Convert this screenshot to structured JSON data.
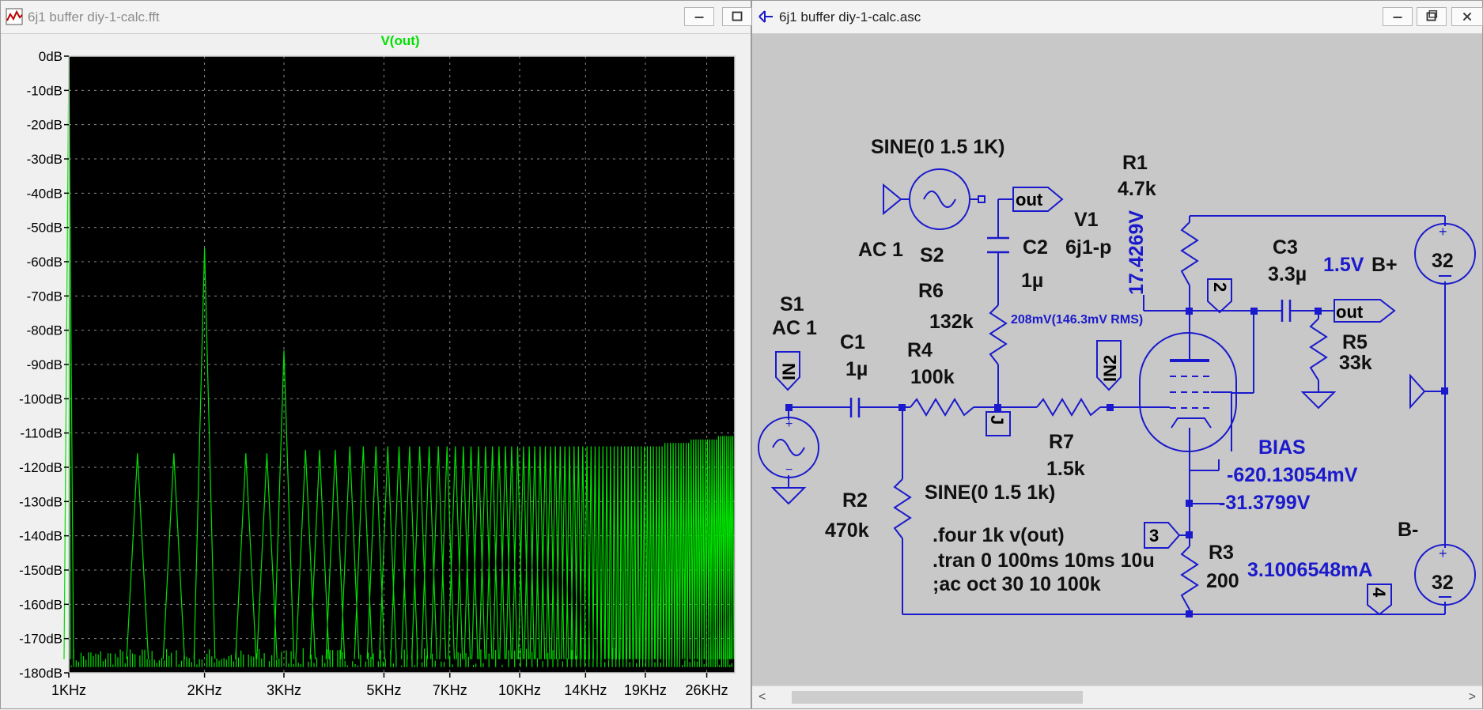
{
  "fft_window": {
    "title": "6j1 buffer diy-1-calc.fft",
    "trace_name": "V(out)"
  },
  "schematic_window": {
    "title": "6j1 buffer diy-1-calc.asc",
    "scroll_left_arrow": "<",
    "scroll_right_arrow": ">"
  },
  "icons": [
    "waveform-app-icon",
    "schematic-app-icon",
    "minimize-icon",
    "maximize-icon",
    "close-icon"
  ],
  "colors": {
    "trace": "#00e000",
    "plot_bg": "#000000",
    "wire": "#1a1acc",
    "schematic_bg": "#c8c8c8"
  },
  "chart_data": {
    "type": "line",
    "title": "V(out)",
    "xlabel": "",
    "ylabel": "",
    "x_scale": "log",
    "xlim": [
      1000,
      30000
    ],
    "ylim": [
      -180,
      0
    ],
    "grid": true,
    "x_ticks": [
      {
        "v": 1000,
        "label": "1KHz"
      },
      {
        "v": 2000,
        "label": "2KHz"
      },
      {
        "v": 3000,
        "label": "3KHz"
      },
      {
        "v": 5000,
        "label": "5KHz"
      },
      {
        "v": 7000,
        "label": "7KHz"
      },
      {
        "v": 10000,
        "label": "10KHz"
      },
      {
        "v": 14000,
        "label": "14KHz"
      },
      {
        "v": 19000,
        "label": "19KHz"
      },
      {
        "v": 26000,
        "label": "26KHz"
      }
    ],
    "y_ticks": [
      {
        "v": 0,
        "label": "0dB"
      },
      {
        "v": -10,
        "label": "-10dB"
      },
      {
        "v": -20,
        "label": "-20dB"
      },
      {
        "v": -30,
        "label": "-30dB"
      },
      {
        "v": -40,
        "label": "-40dB"
      },
      {
        "v": -50,
        "label": "-50dB"
      },
      {
        "v": -60,
        "label": "-60dB"
      },
      {
        "v": -70,
        "label": "-70dB"
      },
      {
        "v": -80,
        "label": "-80dB"
      },
      {
        "v": -90,
        "label": "-90dB"
      },
      {
        "v": -100,
        "label": "-100dB"
      },
      {
        "v": -110,
        "label": "-110dB"
      },
      {
        "v": -120,
        "label": "-120dB"
      },
      {
        "v": -130,
        "label": "-130dB"
      },
      {
        "v": -140,
        "label": "-140dB"
      },
      {
        "v": -150,
        "label": "-150dB"
      },
      {
        "v": -160,
        "label": "-160dB"
      },
      {
        "v": -170,
        "label": "-170dB"
      },
      {
        "v": -180,
        "label": "-180dB"
      }
    ],
    "series": [
      {
        "peaks_hz": [
          1000,
          1420,
          1710,
          2000,
          2470,
          2750,
          3000,
          3350,
          3600,
          3900,
          4200,
          4500,
          4800,
          5100,
          5400,
          5700,
          6000,
          6300,
          6600,
          6900,
          7200,
          7500,
          7800,
          8100,
          8400,
          8700,
          9000,
          9300,
          9600,
          9900,
          10200,
          10500,
          10800,
          11100,
          11400,
          11700,
          12000,
          12300,
          12600,
          12900,
          13200,
          13500,
          13800,
          14100,
          14400,
          14700,
          15000,
          15300,
          15600,
          15900,
          16200,
          16500,
          16800,
          17100,
          17400,
          17700,
          18000,
          18300,
          18600,
          18900,
          19200,
          19500,
          19800,
          20100,
          20400,
          20700,
          21000,
          21300,
          21600,
          21900,
          22200,
          22500,
          22800,
          23100,
          23400,
          23700,
          24000,
          24300,
          24600,
          24900,
          25200,
          25500,
          25800,
          26100,
          26400,
          26700,
          27000,
          27300,
          27600,
          27900,
          28200,
          28500,
          28800,
          29100,
          29400,
          29700
        ],
        "peaks_db": [
          0,
          -116,
          -116,
          -56,
          -116,
          -116,
          -86,
          -115,
          -115,
          -115,
          -114,
          -114,
          -114,
          -114,
          -114,
          -114,
          -114,
          -114,
          -114,
          -114,
          -114,
          -114,
          -114,
          -114,
          -114,
          -114,
          -114,
          -114,
          -114,
          -114,
          -114,
          -114,
          -114,
          -114,
          -114,
          -114,
          -114,
          -114,
          -114,
          -114,
          -114,
          -114,
          -114,
          -114,
          -114,
          -114,
          -114,
          -114,
          -114,
          -114,
          -114,
          -114,
          -114,
          -114,
          -114,
          -114,
          -114,
          -114,
          -114,
          -114,
          -114,
          -114,
          -114,
          -114,
          -114,
          -114,
          -113,
          -113,
          -113,
          -113,
          -113,
          -113,
          -113,
          -113,
          -113,
          -113,
          -112,
          -112,
          -112,
          -112,
          -112,
          -112,
          -112,
          -112,
          -112,
          -112,
          -112,
          -112,
          -111,
          -111,
          -111,
          -111,
          -111,
          -111,
          -111,
          -111
        ],
        "floor_db": -176
      }
    ]
  },
  "schematic": {
    "texts": {
      "s1_name": "S1",
      "s1_ac": "AC 1",
      "c1_name": "C1",
      "c1_val": "1µ",
      "r4_name": "R4",
      "r4_val": "100k",
      "r6_name": "R6",
      "r6_val": "132k",
      "s2_ac": "AC 1",
      "s2_name": "S2",
      "s2_sine": "SINE(0 1.5 1K)",
      "c2_name": "C2",
      "c2_val": "1µ",
      "v1_name": "V1",
      "v1_val": "6j1-p",
      "r1_name": "R1",
      "r1_val": "4.7k",
      "r1_voltage": "17.4269V",
      "rms_note": "208mV(146.3mV RMS)",
      "c3_name": "C3",
      "c3_val": "3.3µ",
      "bplus_volt": "1.5V",
      "bplus_label": "B+",
      "bplus_val": "32",
      "r5_name": "R5",
      "r5_val": "33k",
      "r7_name": "R7",
      "r7_val": "1.5k",
      "bias_label": "BIAS",
      "bias_mv": "-620.13054mV",
      "cathode_v": "-31.3799V",
      "r2_name": "R2",
      "r2_val": "470k",
      "s1_sine": "SINE(0 1.5 1k)",
      "dir_four": ".four 1k v(out)",
      "dir_tran": ".tran 0 100ms 10ms 10u",
      "dir_ac": ";ac oct 30 10 100k",
      "r3_name": "R3",
      "r3_val": "200",
      "r3_current": "3.1006548mA",
      "bminus_label": "B-",
      "bminus_val": "32"
    },
    "nets": {
      "in": "IN",
      "in2": "IN2",
      "j": "J",
      "out_left": "out",
      "out_right": "out",
      "n2": "2",
      "n3": "3",
      "n4": "4"
    }
  }
}
